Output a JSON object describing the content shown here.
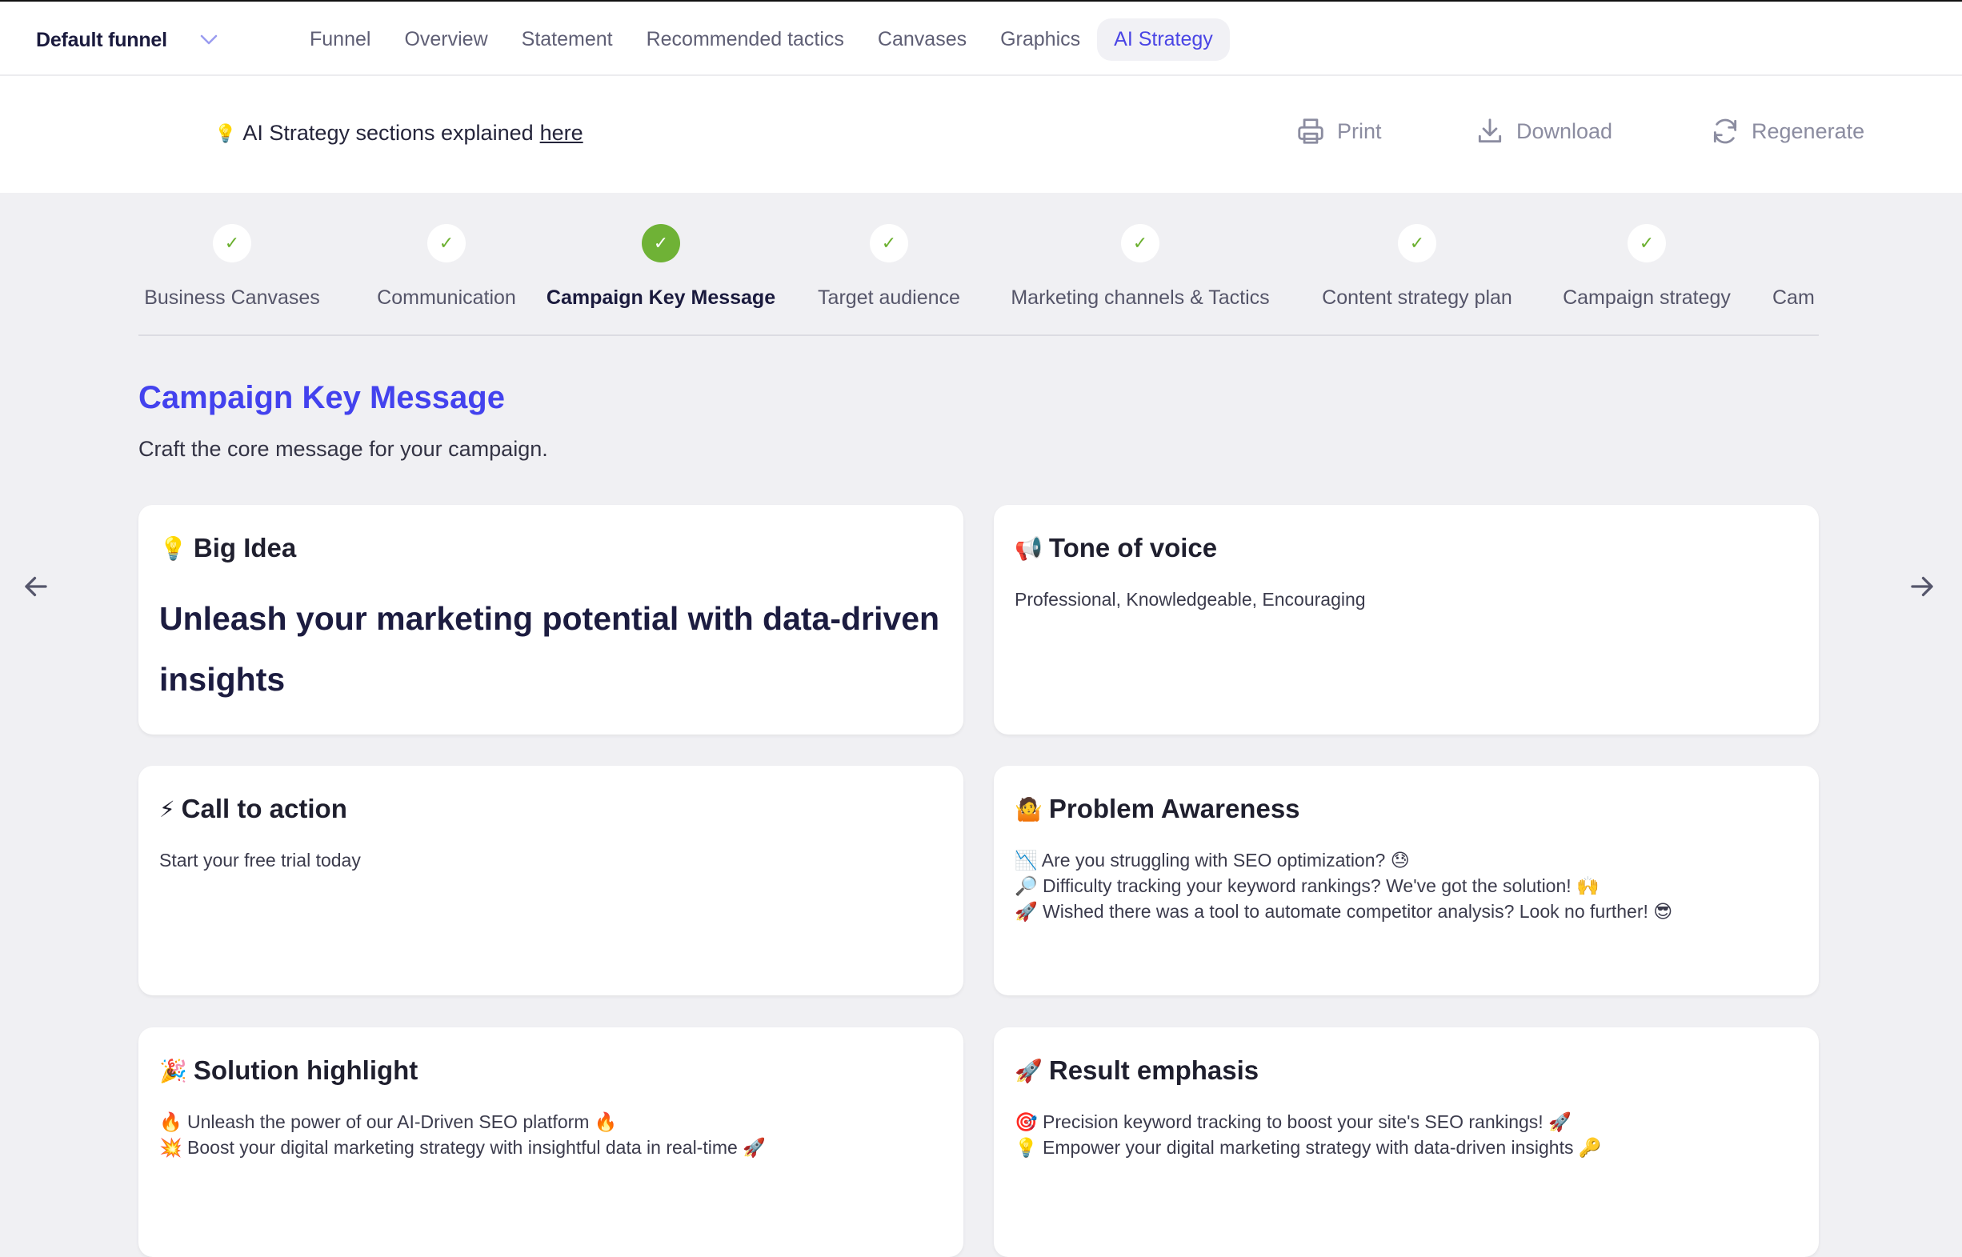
{
  "topnav": {
    "funnel_select": "Default funnel",
    "tabs": [
      {
        "label": "Funnel",
        "active": false
      },
      {
        "label": "Overview",
        "active": false
      },
      {
        "label": "Statement",
        "active": false
      },
      {
        "label": "Recommended tactics",
        "active": false
      },
      {
        "label": "Canvases",
        "active": false
      },
      {
        "label": "Graphics",
        "active": false
      },
      {
        "label": "AI Strategy",
        "active": true
      }
    ]
  },
  "toolbar": {
    "info_icon": "💡",
    "info_text": "AI Strategy sections explained",
    "info_link": "here",
    "print_label": "Print",
    "download_label": "Download",
    "regenerate_label": "Regenerate"
  },
  "stepper": {
    "steps": [
      {
        "label": "Business Canvases",
        "done": true,
        "active": false
      },
      {
        "label": "Communication",
        "done": true,
        "active": false
      },
      {
        "label": "Campaign Key Message",
        "done": true,
        "active": true
      },
      {
        "label": "Target audience",
        "done": true,
        "active": false
      },
      {
        "label": "Marketing channels & Tactics",
        "done": true,
        "active": false
      },
      {
        "label": "Content strategy plan",
        "done": true,
        "active": false
      },
      {
        "label": "Campaign strategy",
        "done": true,
        "active": false
      },
      {
        "label": "Cam",
        "done": true,
        "active": false
      }
    ],
    "check_glyph": "✓"
  },
  "section": {
    "title": "Campaign Key Message",
    "subtitle": "Craft the core message for your campaign."
  },
  "cards": {
    "big_idea": {
      "emoji": "💡",
      "title": "Big Idea",
      "body": "Unleash your marketing potential with data-driven insights"
    },
    "tone": {
      "emoji": "📢",
      "title": "Tone of voice",
      "body": "Professional, Knowledgeable, Encouraging"
    },
    "cta": {
      "emoji": "⚡",
      "title": "Call to action",
      "body": "Start your free trial today"
    },
    "problem": {
      "emoji": "🤷",
      "title": "Problem Awareness",
      "lines": [
        "📉 Are you struggling with SEO optimization? 😓",
        "🔎 Difficulty tracking your keyword rankings? We've got the solution! 🙌",
        "🚀 Wished there was a tool to automate competitor analysis? Look no further! 😎"
      ]
    },
    "solution": {
      "emoji": "🎉",
      "title": "Solution highlight",
      "lines": [
        "🔥 Unleash the power of our AI-Driven SEO platform 🔥",
        "💥 Boost your digital marketing strategy with insightful data in real-time 🚀"
      ]
    },
    "result": {
      "emoji": "🚀",
      "title": "Result emphasis",
      "lines": [
        "🎯 Precision keyword tracking to boost your site's SEO rankings! 🚀",
        "💡 Empower your digital marketing strategy with data-driven insights 🔑"
      ]
    }
  },
  "colors": {
    "accent": "#4342ee",
    "success": "#6fb236",
    "background": "#f0f0f3"
  }
}
